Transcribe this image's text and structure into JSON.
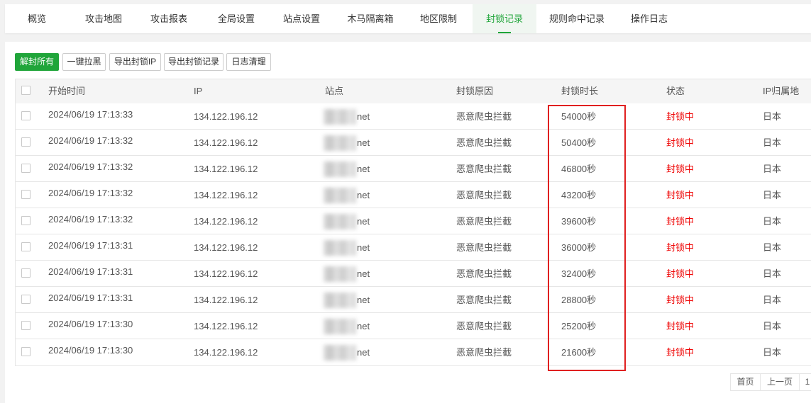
{
  "tabs": [
    {
      "label": "概览",
      "active": false
    },
    {
      "label": "攻击地图",
      "active": false
    },
    {
      "label": "攻击报表",
      "active": false
    },
    {
      "label": "全局设置",
      "active": false
    },
    {
      "label": "站点设置",
      "active": false
    },
    {
      "label": "木马隔离箱",
      "active": false
    },
    {
      "label": "地区限制",
      "active": false
    },
    {
      "label": "封锁记录",
      "active": true
    },
    {
      "label": "规则命中记录",
      "active": false
    },
    {
      "label": "操作日志",
      "active": false
    }
  ],
  "toolbar": {
    "unblock_all": "解封所有",
    "blacklist": "一键拉黑",
    "export_ip": "导出封锁IP",
    "export_records": "导出封锁记录",
    "clear_logs": "日志清理"
  },
  "table": {
    "headers": {
      "start_time": "开始时间",
      "ip": "IP",
      "site": "站点",
      "reason": "封锁原因",
      "duration": "封锁时长",
      "status": "状态",
      "location": "IP归属地"
    },
    "rows": [
      {
        "time": "2024/06/19 17:13:33",
        "ip": "134.122.196.12",
        "site": "net",
        "reason": "恶意爬虫拦截",
        "duration": "54000秒",
        "status": "封锁中",
        "location": "日本"
      },
      {
        "time": "2024/06/19 17:13:32",
        "ip": "134.122.196.12",
        "site": "net",
        "reason": "恶意爬虫拦截",
        "duration": "50400秒",
        "status": "封锁中",
        "location": "日本"
      },
      {
        "time": "2024/06/19 17:13:32",
        "ip": "134.122.196.12",
        "site": "net",
        "reason": "恶意爬虫拦截",
        "duration": "46800秒",
        "status": "封锁中",
        "location": "日本"
      },
      {
        "time": "2024/06/19 17:13:32",
        "ip": "134.122.196.12",
        "site": "net",
        "reason": "恶意爬虫拦截",
        "duration": "43200秒",
        "status": "封锁中",
        "location": "日本"
      },
      {
        "time": "2024/06/19 17:13:32",
        "ip": "134.122.196.12",
        "site": "net",
        "reason": "恶意爬虫拦截",
        "duration": "39600秒",
        "status": "封锁中",
        "location": "日本"
      },
      {
        "time": "2024/06/19 17:13:31",
        "ip": "134.122.196.12",
        "site": "net",
        "reason": "恶意爬虫拦截",
        "duration": "36000秒",
        "status": "封锁中",
        "location": "日本"
      },
      {
        "time": "2024/06/19 17:13:31",
        "ip": "134.122.196.12",
        "site": "net",
        "reason": "恶意爬虫拦截",
        "duration": "32400秒",
        "status": "封锁中",
        "location": "日本"
      },
      {
        "time": "2024/06/19 17:13:31",
        "ip": "134.122.196.12",
        "site": "net",
        "reason": "恶意爬虫拦截",
        "duration": "28800秒",
        "status": "封锁中",
        "location": "日本"
      },
      {
        "time": "2024/06/19 17:13:30",
        "ip": "134.122.196.12",
        "site": "net",
        "reason": "恶意爬虫拦截",
        "duration": "25200秒",
        "status": "封锁中",
        "location": "日本"
      },
      {
        "time": "2024/06/19 17:13:30",
        "ip": "134.122.196.12",
        "site": "net",
        "reason": "恶意爬虫拦截",
        "duration": "21600秒",
        "status": "封锁中",
        "location": "日本"
      }
    ]
  },
  "pagination": {
    "first": "首页",
    "prev": "上一页",
    "current": "1"
  },
  "colors": {
    "accent": "#20a53a",
    "status_blocked": "#ef0808",
    "highlight_box": "#e02020"
  }
}
